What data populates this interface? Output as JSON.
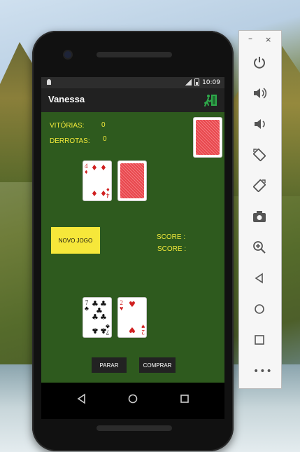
{
  "status_bar": {
    "time": "10:09"
  },
  "app_bar": {
    "title": "Vanessa"
  },
  "stats": {
    "wins_label": "VITÓRIAS:",
    "wins_value": "0",
    "losses_label": "DERROTAS:",
    "losses_value": "0"
  },
  "buttons": {
    "new_game": "NOVO JOGO",
    "stop": "PARAR",
    "buy": "COMPRAR"
  },
  "scores": {
    "score1_label": "SCORE :",
    "score2_label": "SCORE :"
  },
  "cards": {
    "dealer_card_rank": "4",
    "dealer_card_suit": "♦",
    "player_card1_rank": "7",
    "player_card1_suit": "♣",
    "player_card2_rank": "2",
    "player_card2_suit": "♥"
  },
  "emulator_toolbar": {
    "minimize": "–",
    "close": "×",
    "more": "•••"
  },
  "colors": {
    "felt": "#2e5a1e",
    "accent_yellow": "#f6e73a",
    "card_red": "#e8474d"
  }
}
